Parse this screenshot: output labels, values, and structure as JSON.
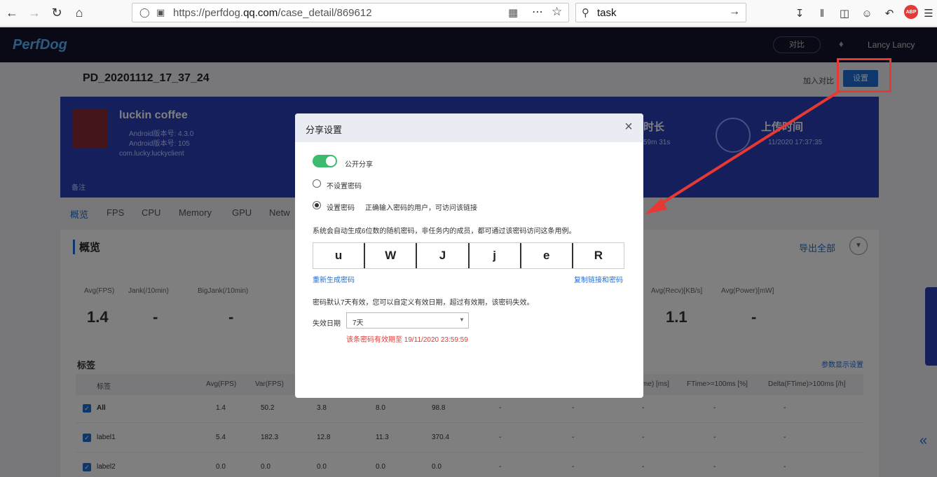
{
  "browser": {
    "url_prefix": "https://perfdog.",
    "url_domain": "qq.com",
    "url_path": "/case_detail/869612",
    "search_text": "task",
    "abp": "ABP"
  },
  "app": {
    "logo": "PerfDog",
    "compare": "对比",
    "user": "Lancy Lancy",
    "case_title": "PD_20201112_17_37_24",
    "add_compare": "加入对比",
    "settings": "设置",
    "app_name": "luckin coffee",
    "android_version": "Android版本号: 4.3.0",
    "android_code": "Android版本号: 105",
    "package": "com.lucky.luckyclient",
    "note": "备注",
    "duration_label": "时长",
    "duration_value": "59m 31s",
    "upload_label": "上传时间",
    "upload_value": "11/2020 17:37:35",
    "tabs": [
      "概览",
      "FPS",
      "CPU",
      "Memory",
      "GPU",
      "Netw"
    ],
    "overview_title": "概览",
    "export": "导出全部",
    "stats": [
      {
        "label": "Avg(FPS)",
        "value": "1.4"
      },
      {
        "label": "Jank(/10min)",
        "value": "-"
      },
      {
        "label": "BigJank(/10min)",
        "value": "-"
      },
      {
        "label": "Avg(Recv)[KB/s]",
        "value": "1.1"
      },
      {
        "label": "Avg(Power)[mW]",
        "value": "-"
      }
    ],
    "tags_title": "标签",
    "param_link": "参数显示设置",
    "table_headers": [
      "标签",
      "Avg(FPS)",
      "Var(FPS)",
      "me) [ms]",
      "FTime>=100ms [%]",
      "Delta(FTime)>100ms [/h]"
    ],
    "rows": [
      {
        "name": "All",
        "vals": [
          "1.4",
          "50.2",
          "3.8",
          "8.0",
          "98.8",
          "-",
          "-",
          "-",
          "-",
          "-"
        ]
      },
      {
        "name": "label1",
        "vals": [
          "5.4",
          "182.3",
          "12.8",
          "11.3",
          "370.4",
          "-",
          "-",
          "-",
          "-",
          "-"
        ]
      },
      {
        "name": "label2",
        "vals": [
          "0.0",
          "0.0",
          "0.0",
          "0.0",
          "0.0",
          "-",
          "-",
          "-",
          "-",
          "-"
        ]
      }
    ]
  },
  "modal": {
    "title": "分享设置",
    "public_share": "公开分享",
    "no_password": "不设置密码",
    "set_password": "设置密码",
    "set_password_hint": "正确输入密码的用户，可访问该链接",
    "desc": "系统会自动生成6位数的随机密码，非任务内的成员，都可通过该密码访问这条用例。",
    "password_chars": [
      "u",
      "W",
      "J",
      "j",
      "e",
      "R"
    ],
    "regenerate": "重新生成密码",
    "copy_link": "复制链接和密码",
    "validity_desc": "密码默认7天有效，您可以自定义有效日期，超过有效期，该密码失效。",
    "expiry_label": "失效日期",
    "expiry_value": "7天",
    "expiry_note": "该条密码有效期至 19/11/2020 23:59:59"
  }
}
